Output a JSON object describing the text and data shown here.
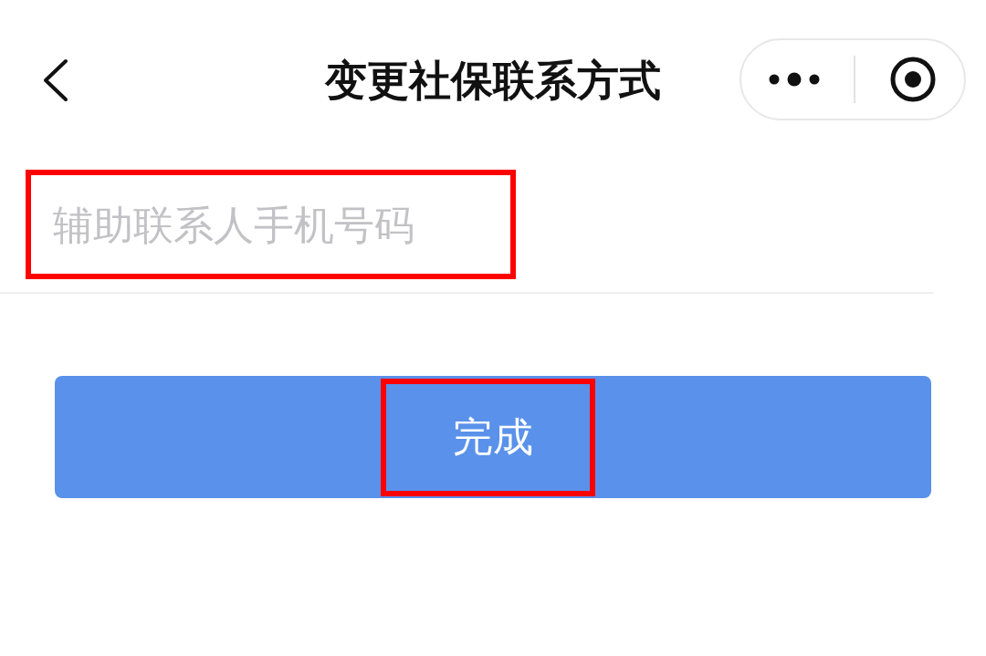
{
  "header": {
    "title": "变更社保联系方式"
  },
  "phone_field": {
    "placeholder": "辅助联系人手机号码",
    "highlighted": true
  },
  "submit_button": {
    "label": "完成",
    "highlighted": true
  }
}
